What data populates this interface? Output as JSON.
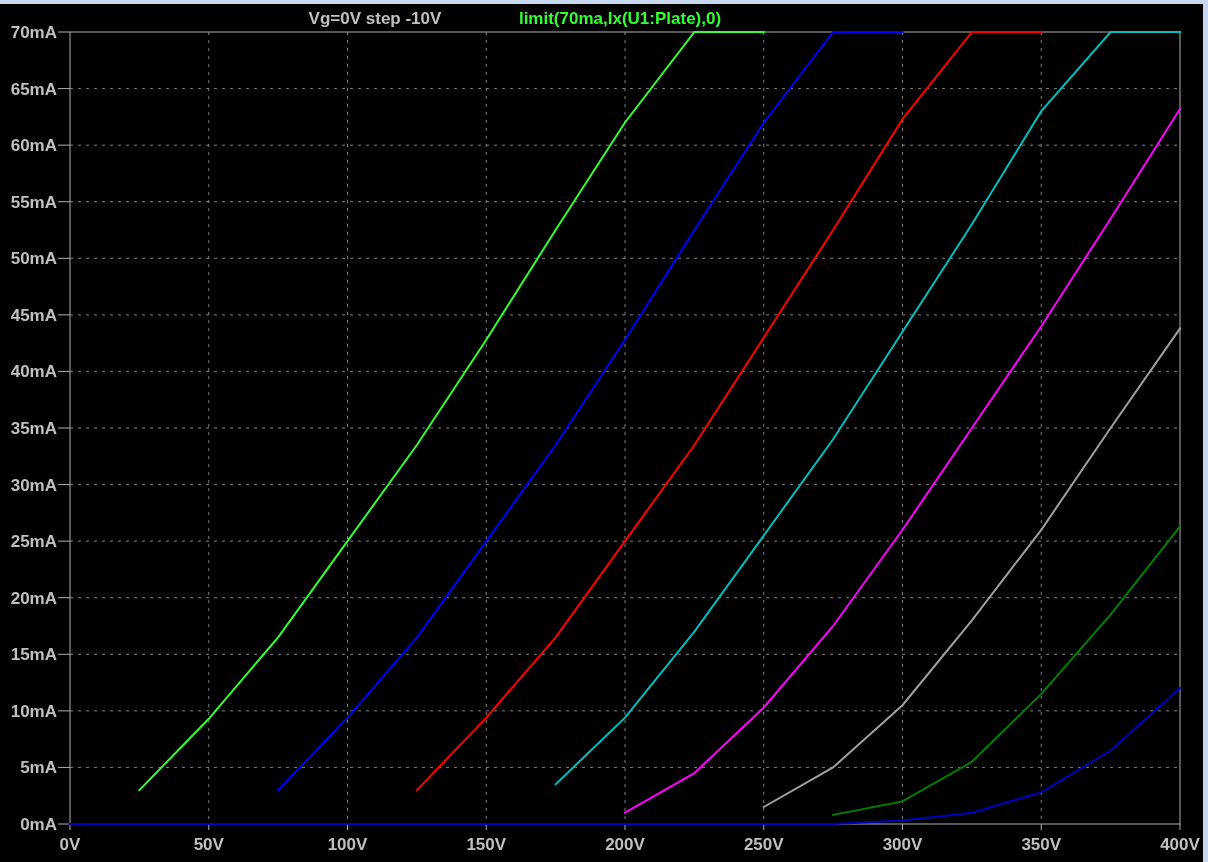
{
  "plot": {
    "step_label": "Vg=0V step -10V",
    "trace_label": "limit(70ma,Ix(U1:Plate),0)",
    "chart_data": {
      "type": "line",
      "x": [
        0,
        25,
        50,
        75,
        100,
        125,
        150,
        175,
        200,
        225,
        250,
        275,
        300,
        325,
        350,
        375,
        400
      ],
      "xlim": [
        0,
        400
      ],
      "ylim": [
        0,
        70
      ],
      "grid": true,
      "xticks": [
        {
          "value": 0,
          "label": "0V"
        },
        {
          "value": 50,
          "label": "50V"
        },
        {
          "value": 100,
          "label": "100V"
        },
        {
          "value": 150,
          "label": "150V"
        },
        {
          "value": 200,
          "label": "200V"
        },
        {
          "value": 250,
          "label": "250V"
        },
        {
          "value": 300,
          "label": "300V"
        },
        {
          "value": 350,
          "label": "350V"
        },
        {
          "value": 400,
          "label": "400V"
        }
      ],
      "yticks": [
        {
          "value": 0,
          "label": "0mA"
        },
        {
          "value": 5,
          "label": "5mA"
        },
        {
          "value": 10,
          "label": "10mA"
        },
        {
          "value": 15,
          "label": "15mA"
        },
        {
          "value": 20,
          "label": "20mA"
        },
        {
          "value": 25,
          "label": "25mA"
        },
        {
          "value": 30,
          "label": "30mA"
        },
        {
          "value": 35,
          "label": "35mA"
        },
        {
          "value": 40,
          "label": "40mA"
        },
        {
          "value": 45,
          "label": "45mA"
        },
        {
          "value": 50,
          "label": "50mA"
        },
        {
          "value": 55,
          "label": "55mA"
        },
        {
          "value": 60,
          "label": "60mA"
        },
        {
          "value": 65,
          "label": "65mA"
        },
        {
          "value": 70,
          "label": "70mA"
        }
      ],
      "series": [
        {
          "color": "#33ff33",
          "values": [
            null,
            3,
            9.3,
            16.5,
            25,
            33.5,
            42.8,
            52.5,
            62,
            70,
            70,
            null,
            null,
            null,
            null,
            null,
            null
          ]
        },
        {
          "color": "#0000ff",
          "values": [
            null,
            null,
            null,
            3,
            9.4,
            16.5,
            25,
            33.5,
            42.8,
            52.5,
            62,
            70,
            70,
            null,
            null,
            null,
            null
          ]
        },
        {
          "color": "#ff0000",
          "values": [
            null,
            null,
            null,
            null,
            null,
            3,
            9.4,
            16.5,
            25,
            33.5,
            43,
            52.5,
            62.3,
            70,
            70,
            null,
            null
          ]
        },
        {
          "color": "#00c0c0",
          "values": [
            null,
            null,
            null,
            null,
            null,
            null,
            null,
            3.5,
            9.4,
            17,
            25.5,
            34,
            43.5,
            53,
            63,
            70,
            70
          ]
        },
        {
          "color": "#ff00ff",
          "values": [
            null,
            null,
            null,
            null,
            null,
            null,
            null,
            null,
            1,
            4.5,
            10.3,
            17.5,
            26,
            35,
            44,
            53.5,
            63.2
          ]
        },
        {
          "color": "#a0a0a0",
          "values": [
            null,
            null,
            null,
            null,
            null,
            null,
            null,
            null,
            null,
            null,
            1.5,
            5,
            10.5,
            18,
            26,
            35,
            43.8
          ]
        },
        {
          "color": "#008000",
          "values": [
            null,
            null,
            null,
            null,
            null,
            null,
            null,
            null,
            null,
            null,
            null,
            0.8,
            2,
            5.5,
            11.5,
            18.5,
            26.3
          ]
        },
        {
          "color": "#0000c0",
          "values": [
            0,
            0,
            0,
            0,
            0,
            0,
            0,
            0,
            0,
            0,
            0,
            0,
            0.3,
            1,
            2.8,
            6.5,
            12
          ]
        }
      ]
    }
  }
}
